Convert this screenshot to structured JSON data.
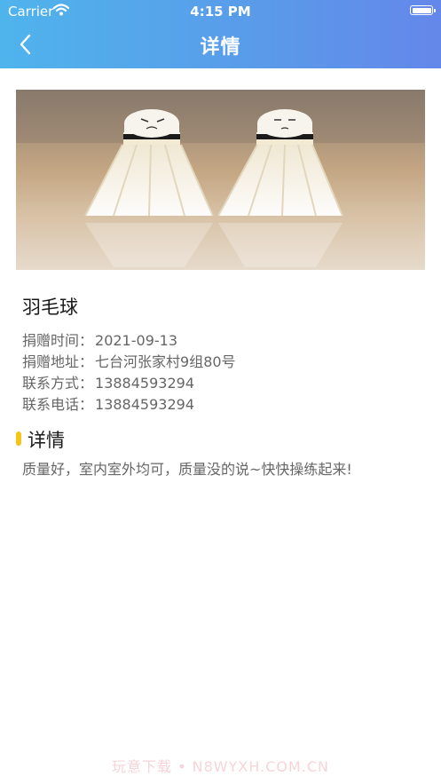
{
  "status_bar": {
    "carrier": "Carrier",
    "time": "4:15 PM"
  },
  "nav": {
    "title": "详情"
  },
  "item": {
    "name": "羽毛球",
    "fields": [
      {
        "label": "捐赠时间：",
        "value": "2021-09-13"
      },
      {
        "label": "捐赠地址：",
        "value": "七台河张家村9组80号"
      },
      {
        "label": "联系方式：",
        "value": "13884593294"
      },
      {
        "label": "联系电话：",
        "value": "13884593294"
      }
    ]
  },
  "details": {
    "heading": "详情",
    "text": "质量好，室内室外均可，质量没的说~快快操练起来!"
  },
  "watermark": "玩意下载 • N8WYXH.COM.CN",
  "colors": {
    "header_start": "#4fb4ec",
    "header_end": "#6487ea",
    "accent": "#f4c419"
  },
  "icons": [
    "wifi-icon",
    "battery-icon",
    "back-chevron-icon"
  ]
}
